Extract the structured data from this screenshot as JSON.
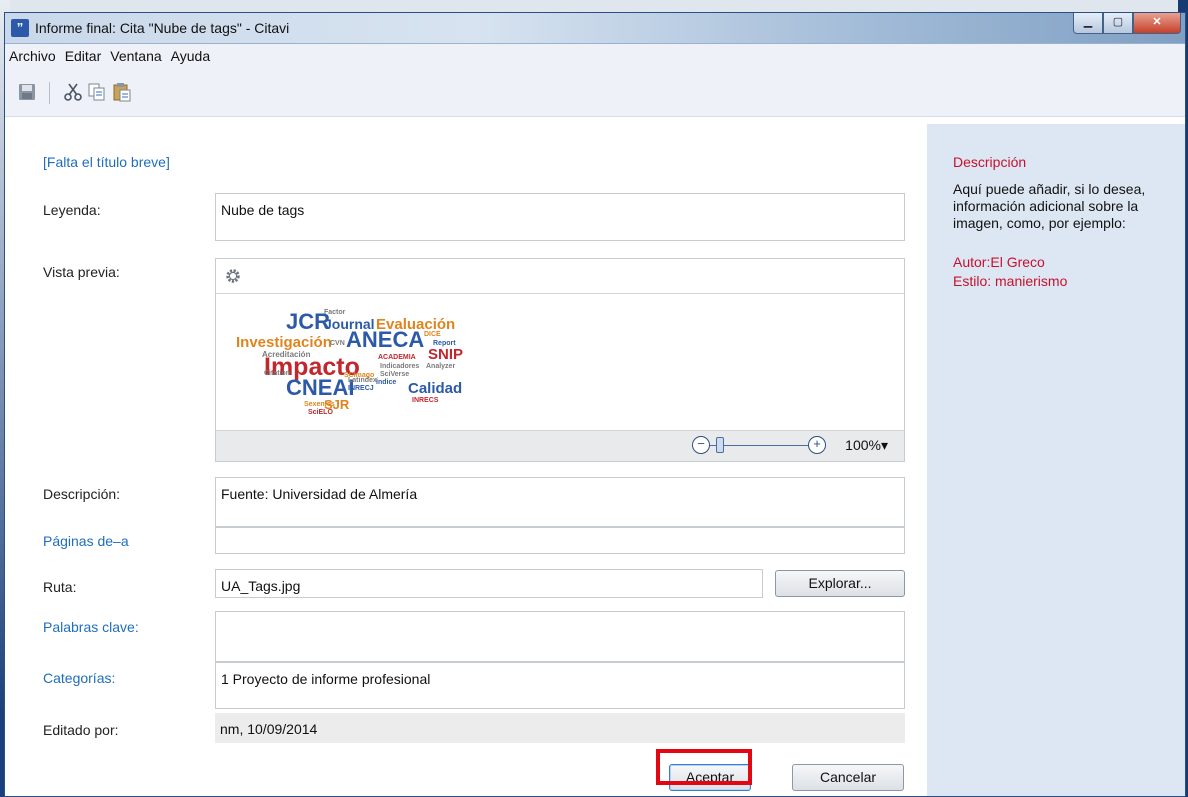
{
  "window": {
    "title": "Informe final: Cita \"Nube de tags\" - Citavi",
    "app_icon_glyph": "”",
    "controls": [
      "minimize-icon",
      "maximize-icon",
      "close-icon"
    ]
  },
  "menu": [
    "Archivo",
    "Editar",
    "Ventana",
    "Ayuda"
  ],
  "toolbar": [
    "save-icon",
    "cut-icon",
    "copy-icon",
    "paste-icon"
  ],
  "form": {
    "short_title": "[Falta el título breve]",
    "caption_label": "Leyenda:",
    "caption_value": "Nube de tags",
    "preview_label": "Vista previa:",
    "zoom": "100%",
    "zoom_arrow": "▾",
    "zoom_out": "−",
    "zoom_in": "+",
    "description_label": "Descripción:",
    "description_value": "Fuente: Universidad de Almería",
    "pages_label": "Páginas de–a",
    "pages_value": "",
    "path_label": "Ruta:",
    "path_value": "UA_Tags.jpg",
    "browse_button": "Explorar...",
    "keywords_label": "Palabras clave:",
    "keywords_value": "",
    "categories_label": "Categorías:",
    "categories_value": "1 Proyecto de informe profesional",
    "edited_by_label": "Editado por:",
    "edited_by_value": "nm, 10/09/2014"
  },
  "buttons": {
    "ok": "Aceptar",
    "cancel": "Cancelar"
  },
  "sidebar": {
    "title": "Descripción",
    "text": "Aquí puede añadir, si lo desea, información adicional sobre la imagen, como, por ejemplo:",
    "author": "Autor:El Greco",
    "style": "Estilo: manierismo"
  },
  "tag_cloud": [
    {
      "text": "JCR",
      "color": "#2c5aa8"
    },
    {
      "text": "Factor",
      "color": "#7a7a7a"
    },
    {
      "text": "Journal",
      "color": "#2c5aa8"
    },
    {
      "text": "Evaluación",
      "color": "#e0851e"
    },
    {
      "text": "Investigación",
      "color": "#e0851e"
    },
    {
      "text": "CVN",
      "color": "#7a7a7a"
    },
    {
      "text": "ANECA",
      "color": "#2c5aa8"
    },
    {
      "text": "DICE",
      "color": "#e0851e"
    },
    {
      "text": "Report",
      "color": "#2c5aa8"
    },
    {
      "text": "Acreditación",
      "color": "#7a7a7a"
    },
    {
      "text": "SNIP",
      "color": "#c1272d"
    },
    {
      "text": "Impacto",
      "color": "#c1272d"
    },
    {
      "text": "ACADEMIA",
      "color": "#c1272d"
    },
    {
      "text": "Indicadores",
      "color": "#7a7a7a"
    },
    {
      "text": "Analyzer",
      "color": "#7a7a7a"
    },
    {
      "text": "Citation",
      "color": "#7a7a7a"
    },
    {
      "text": "SCImago",
      "color": "#e0851e"
    },
    {
      "text": "SciVerse",
      "color": "#7a7a7a"
    },
    {
      "text": "Índice",
      "color": "#2c5aa8"
    },
    {
      "text": "CNEAI",
      "color": "#2c5aa8"
    },
    {
      "text": "Latindex",
      "color": "#7a7a7a"
    },
    {
      "text": "INRECJ",
      "color": "#2c5aa8"
    },
    {
      "text": "Calidad",
      "color": "#2c5aa8"
    },
    {
      "text": "INRECS",
      "color": "#c1272d"
    },
    {
      "text": "Sexenios",
      "color": "#e0851e"
    },
    {
      "text": "SJR",
      "color": "#e0851e"
    },
    {
      "text": "SciELO",
      "color": "#c1272d"
    }
  ]
}
